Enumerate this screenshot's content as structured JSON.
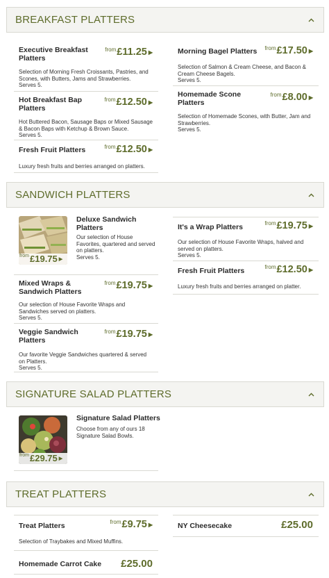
{
  "colors": {
    "accent": "#5e6c2b",
    "header_bg": "#f4f4f1",
    "border": "#d9d9d2"
  },
  "icons": {
    "collapse": "chevron-up-icon",
    "go": "caret-right-icon"
  },
  "sections": [
    {
      "title": "BREAKFAST PLATTERS",
      "items": [
        {
          "name": "Executive Breakfast Platters",
          "from": "from",
          "price": "£11.25",
          "desc": "Selection of Morning Fresh Croissants, Pastries, and Scones, with Butters, Jams and Strawberries.",
          "serves": "Serves 5."
        },
        {
          "name": "Hot Breakfast Bap Platters",
          "from": "from",
          "price": "£12.50",
          "desc": "Hot Buttered Bacon, Sausage Baps or Mixed Sausage & Bacon Baps with Ketchup & Brown Sauce.",
          "serves": "Serves 5."
        },
        {
          "name": "Fresh Fruit Platters",
          "from": "from",
          "price": "£12.50",
          "desc": "Luxury fresh fruits and berries arranged on platters."
        },
        {
          "name": "Morning Bagel Platters",
          "from": "from",
          "price": "£17.50",
          "desc": "Selection of Salmon & Cream Cheese, and Bacon & Cream Cheese Bagels.",
          "serves": "Serves 5."
        },
        {
          "name": "Homemade Scone Platters",
          "from": "from",
          "price": "£8.00",
          "desc": "Selection of Homemade Scones, with Butter, Jam and Strawberries.",
          "serves": "Serves 5."
        }
      ]
    },
    {
      "title": "SANDWICH PLATTERS",
      "items": [
        {
          "name": "Deluxe Sandwich Platters",
          "from": "from",
          "price": "£19.75",
          "desc": "Our selection of House Favorites, quartered and served on platters.",
          "serves": "Serves 5."
        },
        {
          "name": "Mixed Wraps & Sandwich Platters",
          "from": "from",
          "price": "£19.75",
          "desc": "Our selection of House Favorite Wraps and Sandwiches served on platters.",
          "serves": "Serves 5."
        },
        {
          "name": "Veggie Sandwich Platters",
          "from": "from",
          "price": "£19.75",
          "desc": "Our favorite Veggie Sandwiches quartered & served on Platters.",
          "serves": "Serves 5."
        },
        {
          "name": "It's a Wrap Platters",
          "from": "from",
          "price": "£19.75",
          "desc": "Our selection of House Favorite Wraps, halved and served on platters.",
          "serves": "Serves 5."
        },
        {
          "name": "Fresh Fruit Platters",
          "from": "from",
          "price": "£12.50",
          "desc": "Luxury fresh fruits and berries arranged on platter."
        }
      ]
    },
    {
      "title": "SIGNATURE SALAD PLATTERS",
      "items": [
        {
          "name": "Signature Salad Platters",
          "from": "from",
          "price": "£29.75",
          "desc": "Choose from any of ours 18 Signature Salad Bowls."
        }
      ]
    },
    {
      "title": "TREAT PLATTERS",
      "items": [
        {
          "name": "Treat Platters",
          "from": "from",
          "price": "£9.75",
          "desc": "Selection of Traybakes and Mixed Muffins."
        },
        {
          "name": "Homemade Carrot Cake",
          "price": "£25.00"
        },
        {
          "name": "NY Cheesecake",
          "price": "£25.00"
        }
      ]
    }
  ]
}
